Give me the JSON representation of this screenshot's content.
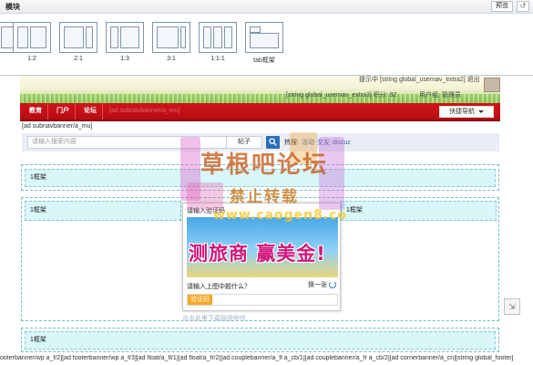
{
  "panel": {
    "title": "模块",
    "preview_label": "预览",
    "layouts": [
      {
        "label": ""
      },
      {
        "label": "1:2"
      },
      {
        "label": "2:1"
      },
      {
        "label": "1:3"
      },
      {
        "label": "3:1"
      },
      {
        "label": "1:1:1"
      },
      {
        "label": "tab框架"
      }
    ]
  },
  "banner": {
    "user_text": "提示中 [string global_usernav_extra2] 退出",
    "extra_text": "[string global_usernav_extra3]  积分: 92",
    "group_text": "用户组: 管理员"
  },
  "nav": {
    "items": [
      "教育",
      "门户",
      "论坛"
    ],
    "faded_text": "[ad subnavbanner/a_mu]",
    "quick_nav": "快捷导航"
  },
  "ad_subnav": "[ad subnavbanner/a_mu]",
  "search": {
    "placeholder": "请输入搜索内容",
    "scope": "帖子",
    "hot_label": "热搜:",
    "hot_terms": [
      "活动",
      "交友",
      "discuz"
    ]
  },
  "frames": {
    "top": "1框架",
    "middle_left": "1框架",
    "middle_right": "1框架",
    "bottom": "1框架"
  },
  "captcha": {
    "title": "请输入验证码",
    "image_text": "测旅商 赢美金!",
    "question": "请输入上图中题什么？",
    "refresh": "换一张",
    "input_label": "验证码",
    "link": "点击此里下载网盘附件"
  },
  "footer_ads": "ooterbanner/wp a_f/2][ad footerbanner/wp a_f/3][ad float/a_fl/1][ad float/a_fr/2][ad couplebanner/a_fl a_cb/1][ad couplebanner/a_fr a_cb/2][ad cornerbanner/a_cn][string global_footer]",
  "watermark": {
    "line1": "草根吧论坛",
    "line2": "禁止转载",
    "line3": "www.caogen8.co"
  },
  "colors": {
    "nav_red": "#c8121a",
    "frame_fill": "#d9f6f9",
    "frame_border": "#6fc0c8",
    "search_bg": "#e9eef5",
    "search_button": "#2b6fb6"
  }
}
